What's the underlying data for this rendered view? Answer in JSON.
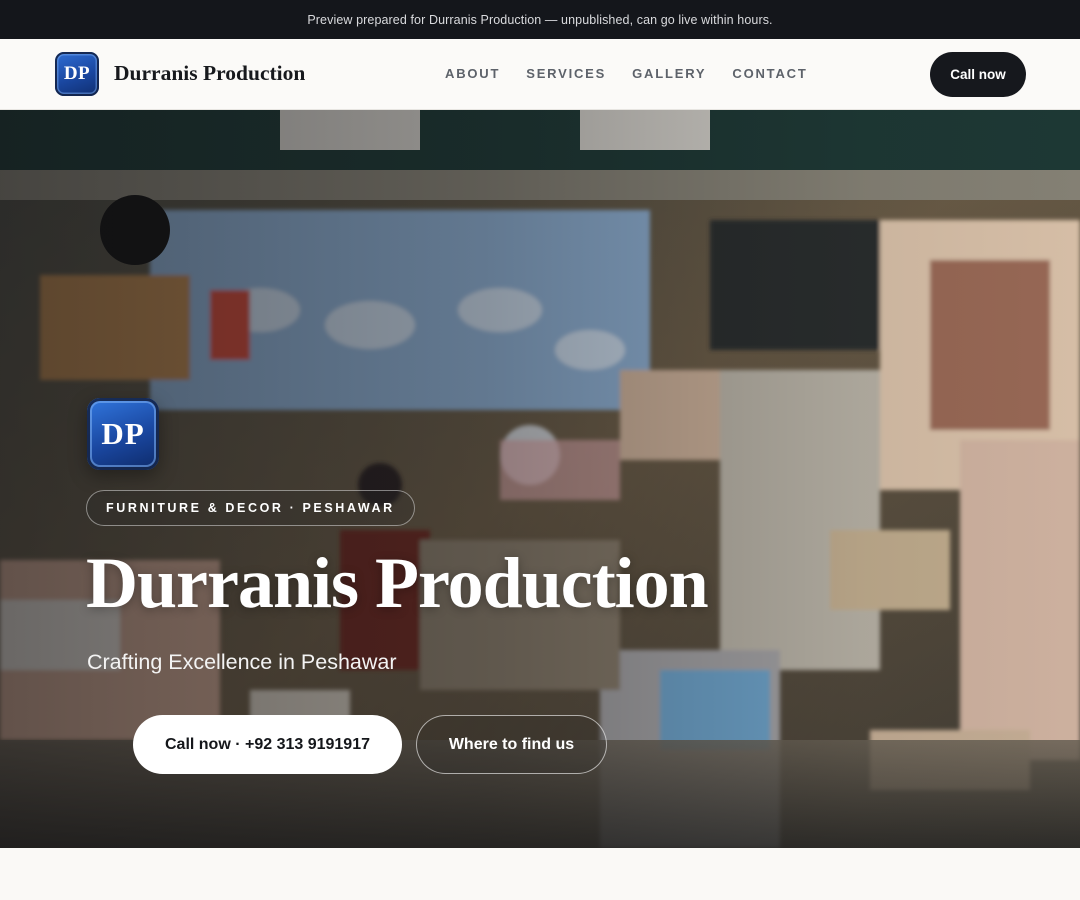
{
  "announcement": "Preview prepared for Durranis Production — unpublished, can go live within hours.",
  "nav": {
    "logo_initials": "DP",
    "brand_name": "Durranis Production",
    "links": [
      "ABOUT",
      "SERVICES",
      "GALLERY",
      "CONTACT"
    ],
    "cta_label": "Call now"
  },
  "hero": {
    "logo_initials": "DP",
    "tagline_pill": "FURNITURE & DECOR · PESHAWAR",
    "title": "Durranis Production",
    "subtitle": "Crafting Excellence in Peshawar",
    "primary_cta": "Call now · +92 313 9191917",
    "secondary_cta": "Where to find us",
    "background_image": "shop-interior-photo"
  },
  "colors": {
    "topbar_bg": "#14161b",
    "primary_dark": "#16181d",
    "logo_blue": "#1a47a0",
    "page_bg": "#faf9f6"
  }
}
